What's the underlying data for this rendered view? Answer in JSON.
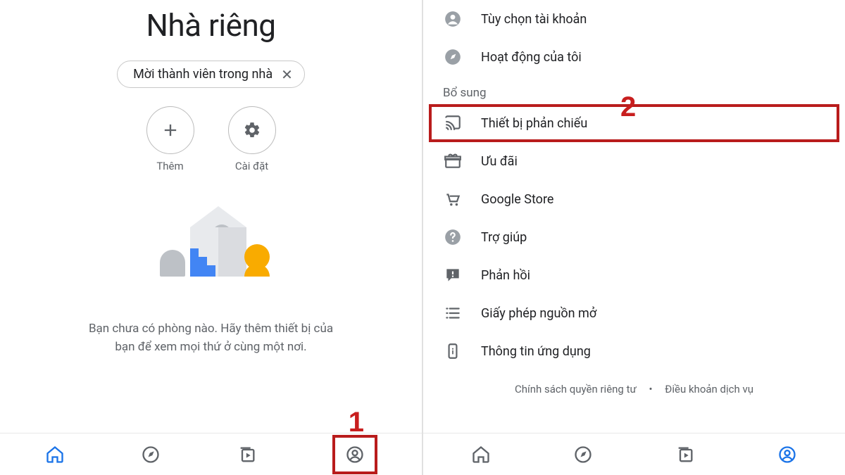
{
  "left": {
    "title": "Nhà riêng",
    "chip_label": "Mời thành viên trong nhà",
    "add_label": "Thêm",
    "settings_label": "Cài đặt",
    "empty_line1": "Bạn chưa có phòng nào. Hãy thêm thiết bị của",
    "empty_line2": "bạn để xem mọi thứ ở cùng một nơi."
  },
  "right": {
    "account_options": "Tùy chọn tài khoản",
    "my_activity": "Hoạt động của tôi",
    "section_supplementary": "Bổ sung",
    "cast_devices": "Thiết bị phản chiếu",
    "offers": "Ưu đãi",
    "google_store": "Google Store",
    "help": "Trợ giúp",
    "feedback": "Phản hồi",
    "open_source": "Giấy phép nguồn mở",
    "app_info": "Thông tin ứng dụng",
    "privacy": "Chính sách quyền riêng tư",
    "terms": "Điều khoản dịch vụ"
  },
  "annotations": {
    "one": "1",
    "two": "2"
  },
  "colors": {
    "accent": "#1a73e8",
    "annotation": "#b91c1c",
    "illu_yellow": "#f9ab00",
    "illu_blue": "#4285f4",
    "illu_grey": "#bdc1c6",
    "illu_light": "#e8eaed"
  }
}
